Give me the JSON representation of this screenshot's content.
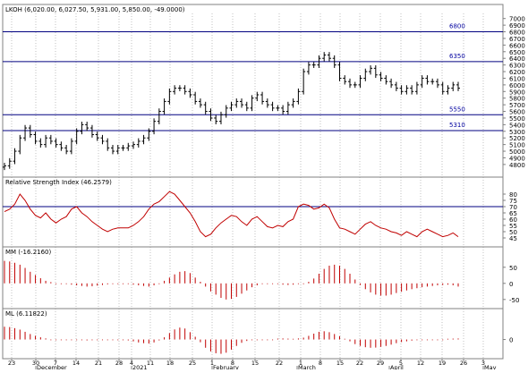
{
  "colors": {
    "background": "#ffffff",
    "frame": "#808080",
    "grid": "#c0c0c0",
    "price_bars": "#000000",
    "level_lines": "#000080",
    "level_labels": "#0000a0",
    "rsi_line": "#c00000",
    "rsi_level": "#000080",
    "histogram": "#c00000",
    "title_text": "#000000"
  },
  "chart_data": [
    {
      "type": "ohlc",
      "title": "LKOH (6,020.00, 6,027.50, 5,931.00, 5,850.00, -49.0000)",
      "yticks": [
        4800,
        4900,
        5000,
        5100,
        5200,
        5300,
        5400,
        5500,
        5600,
        5700,
        5800,
        5900,
        6000,
        6100,
        6200,
        6300,
        6400,
        6500,
        6600,
        6700,
        6800,
        6900,
        7000
      ],
      "ylim": [
        4650,
        7050
      ],
      "levels": [
        {
          "label": "6800",
          "value": 6800
        },
        {
          "label": "6350",
          "value": 6350
        },
        {
          "label": "5550",
          "value": 5550
        },
        {
          "label": "5310",
          "value": 5310
        }
      ],
      "x_date_ticks": [
        "23",
        "30",
        "7",
        "14",
        "21",
        "28",
        "4",
        "11",
        "18",
        "25",
        "1",
        "8",
        "15",
        "22",
        "1",
        "8",
        "15",
        "22",
        "29",
        "5",
        "12",
        "19",
        "26",
        "3"
      ],
      "month_labels": [
        "December",
        "2021",
        "February",
        "March",
        "April",
        "May"
      ],
      "close": [
        4780,
        4850,
        5000,
        5200,
        5350,
        5250,
        5150,
        5100,
        5200,
        5150,
        5100,
        5050,
        5000,
        5150,
        5300,
        5400,
        5350,
        5250,
        5200,
        5150,
        5050,
        5000,
        5050,
        5050,
        5080,
        5100,
        5150,
        5200,
        5300,
        5450,
        5600,
        5750,
        5900,
        5950,
        5950,
        5900,
        5850,
        5750,
        5700,
        5600,
        5500,
        5450,
        5550,
        5650,
        5700,
        5750,
        5700,
        5650,
        5800,
        5850,
        5750,
        5700,
        5650,
        5650,
        5600,
        5700,
        5750,
        5900,
        6200,
        6300,
        6300,
        6400,
        6450,
        6400,
        6300,
        6100,
        6050,
        6000,
        6000,
        6100,
        6200,
        6250,
        6150,
        6100,
        6050,
        6000,
        5950,
        5900,
        5950,
        5900,
        6000,
        6100,
        6050,
        6050,
        6000,
        5900,
        5950,
        6000,
        5950
      ]
    },
    {
      "type": "line",
      "title": "Relative Strength Index (46.2579)",
      "yticks": [
        45,
        50,
        55,
        60,
        65,
        70,
        75,
        80
      ],
      "ylim": [
        40,
        85
      ],
      "level": 70,
      "values": [
        66,
        68,
        72,
        80,
        75,
        68,
        63,
        61,
        65,
        60,
        57,
        60,
        62,
        68,
        70,
        65,
        62,
        58,
        55,
        52,
        50,
        52,
        53,
        53,
        53,
        55,
        58,
        62,
        68,
        72,
        74,
        78,
        82,
        80,
        75,
        70,
        65,
        58,
        50,
        46,
        48,
        53,
        57,
        60,
        63,
        62,
        58,
        55,
        60,
        62,
        58,
        54,
        53,
        55,
        54,
        58,
        60,
        70,
        72,
        71,
        68,
        69,
        72,
        69,
        60,
        53,
        52,
        50,
        48,
        52,
        56,
        58,
        55,
        53,
        52,
        50,
        49,
        47,
        50,
        48,
        46,
        50,
        52,
        50,
        48,
        46,
        47,
        49,
        46
      ]
    },
    {
      "type": "histogram",
      "title": "MM (-16.2160)",
      "yticks": [
        -50,
        0,
        50
      ],
      "ylim": [
        -70,
        80
      ],
      "values": [
        70,
        68,
        64,
        58,
        48,
        36,
        26,
        16,
        8,
        4,
        2,
        0,
        -2,
        -4,
        -6,
        -8,
        -10,
        -9,
        -7,
        -5,
        -3,
        -1,
        0,
        -1,
        -2,
        -4,
        -6,
        -8,
        -10,
        -6,
        0,
        8,
        18,
        28,
        36,
        38,
        32,
        18,
        5,
        -10,
        -25,
        -35,
        -45,
        -50,
        -48,
        -42,
        -32,
        -22,
        -12,
        -6,
        -2,
        0,
        0,
        -2,
        -4,
        -5,
        -4,
        -2,
        0,
        5,
        15,
        30,
        45,
        55,
        58,
        55,
        45,
        30,
        12,
        -5,
        -18,
        -28,
        -35,
        -38,
        -38,
        -35,
        -30,
        -26,
        -22,
        -18,
        -15,
        -12,
        -10,
        -8,
        -6,
        -5,
        -4,
        -6,
        -10
      ]
    },
    {
      "type": "histogram",
      "title": "ML (6.11822)",
      "yticks": [
        0
      ],
      "ylim": [
        -90,
        110
      ],
      "values": [
        70,
        68,
        62,
        54,
        42,
        30,
        20,
        12,
        6,
        3,
        2,
        0,
        -1,
        -2,
        -3,
        -4,
        -5,
        -4,
        -3,
        -2,
        -1,
        0,
        0,
        -2,
        -5,
        -10,
        -16,
        -20,
        -22,
        -16,
        -5,
        12,
        35,
        55,
        65,
        60,
        40,
        15,
        -15,
        -45,
        -65,
        -75,
        -78,
        -72,
        -55,
        -35,
        -18,
        -8,
        -2,
        0,
        0,
        1,
        3,
        5,
        6,
        5,
        4,
        6,
        10,
        20,
        32,
        42,
        45,
        40,
        30,
        18,
        4,
        -10,
        -25,
        -35,
        -42,
        -45,
        -44,
        -40,
        -35,
        -28,
        -20,
        -14,
        -10,
        -6,
        -3,
        -1,
        0,
        1,
        2,
        3,
        4,
        5,
        6
      ]
    }
  ]
}
